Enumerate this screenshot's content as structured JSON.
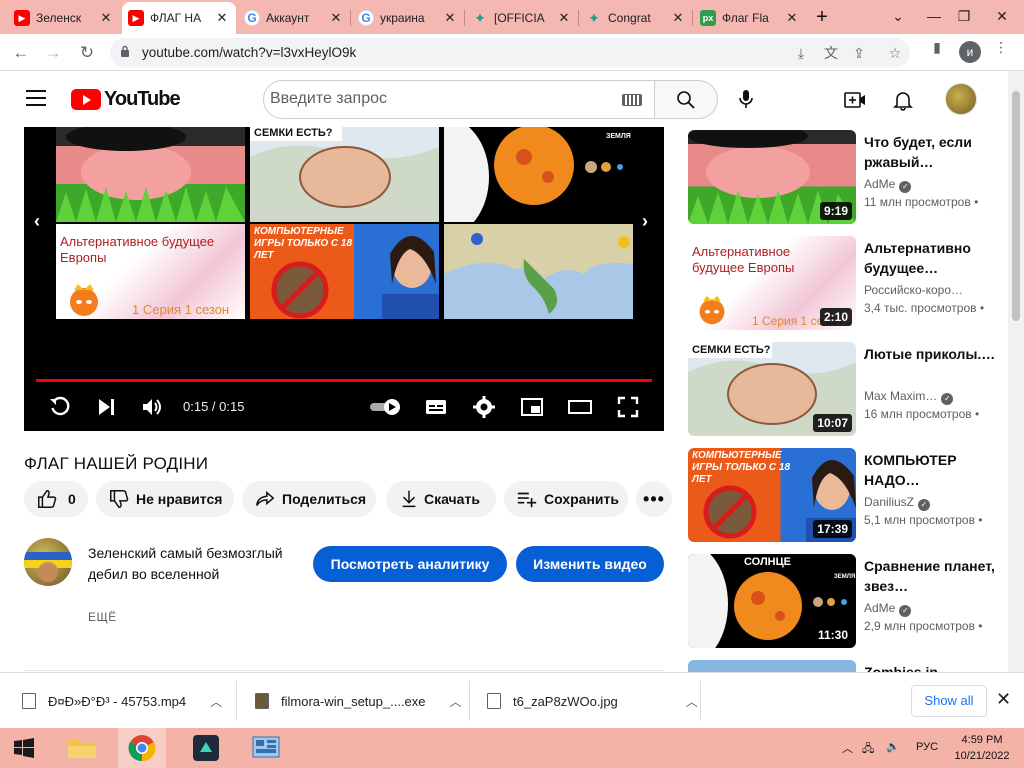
{
  "browser": {
    "tabs": [
      {
        "title": "Зеленск",
        "favicon": "youtube-icon",
        "active": false
      },
      {
        "title": "ФЛАГ НА",
        "favicon": "youtube-icon",
        "active": true
      },
      {
        "title": "Аккаунт",
        "favicon": "google-icon",
        "active": false
      },
      {
        "title": "украина",
        "favicon": "google-icon",
        "active": false
      },
      {
        "title": "[OFFICIA",
        "favicon": "star-icon",
        "active": false
      },
      {
        "title": "Congrat",
        "favicon": "star-icon",
        "active": false
      },
      {
        "title": "Флаг Fla",
        "favicon": "px-icon",
        "active": false
      }
    ],
    "url": "youtube.com/watch?v=l3vxHeylO9k",
    "profile_initial": "и",
    "accent": "#f5b7b1"
  },
  "youtube": {
    "logo_text": "YouTube",
    "search_placeholder": "Введите запрос"
  },
  "player": {
    "time": "0:15 / 0:15",
    "progress": 1.0,
    "end_cards": [
      {
        "caption": ""
      },
      {
        "caption": "СЕМКИ ЕСТЬ?"
      },
      {
        "caption": "ЗЕМЛЯ"
      },
      {
        "caption": "Альтернативное будущее Европы",
        "sub": "1 Серия 1 сезон"
      },
      {
        "caption": "КОМПЬЮТЕРНЫЕ ИГРЫ ТОЛЬКО С 18 ЛЕТ"
      },
      {
        "caption": ""
      }
    ]
  },
  "video": {
    "title": "ФЛАГ НАШЕЙ РОДІНИ",
    "likes": "0",
    "dislike_label": "Не нравится",
    "share_label": "Поделиться",
    "download_label": "Скачать",
    "save_label": "Сохранить",
    "description": "Зеленский самый безмозглый дебил во вселенной",
    "analytics_label": "Посмотреть аналитику",
    "edit_label": "Изменить видео",
    "more_label": "ЕЩЁ"
  },
  "recommendations": [
    {
      "title": "Что будет, если ржавый…",
      "channel": "AdMe",
      "verified": true,
      "views": "11 млн просмотров •",
      "duration": "9:19"
    },
    {
      "title": "Альтернативно будущее…",
      "channel": "Российско-коро…",
      "verified": false,
      "views": "3,4 тыс. просмотров •",
      "duration": "2:10"
    },
    {
      "title": "Лютые приколы.…",
      "channel": "Max Maxim…",
      "verified": true,
      "views": "16 млн просмотров •",
      "duration": "10:07"
    },
    {
      "title": "КОМПЬЮТЕР НАДО…",
      "channel": "DaniliusZ",
      "verified": true,
      "views": "5,1 млн просмотров •",
      "duration": "17:39"
    },
    {
      "title": "Сравнение планет, звез…",
      "channel": "AdMe",
      "verified": true,
      "views": "2,9 млн просмотров •",
      "duration": "11:30"
    },
    {
      "title": "Zombies in",
      "channel": "",
      "verified": false,
      "views": "",
      "duration": ""
    }
  ],
  "thumb_text": {
    "rec1": "Альтернативное будущее Европы",
    "rec1_sub": "1 Серия 1 сезон",
    "rec2": "СЕМКИ ЕСТЬ?",
    "rec3": "КОМПЬЮТЕРНЫЕ ИГРЫ ТОЛЬКО С 18 ЛЕТ",
    "rec4": "СОЛНЦЕ",
    "rec4_sub": "ЗЕМЛЯ"
  },
  "downloads": [
    {
      "name": "Ð¤Ð»Ð°Ð³ - 45753.mp4"
    },
    {
      "name": "filmora-win_setup_....exe"
    },
    {
      "name": "t6_zaP8zWOo.jpg"
    }
  ],
  "show_all_label": "Show all",
  "taskbar": {
    "lang": "РУС",
    "time": "4:59 PM",
    "date": "10/21/2022"
  }
}
